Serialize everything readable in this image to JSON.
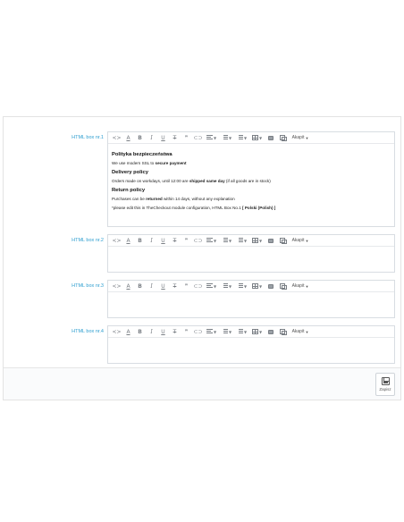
{
  "colors": {
    "label": "#2f9fd0",
    "panel_bg": "#f8f8f8",
    "border": "#d8dde2"
  },
  "toolbar": {
    "code_icon": "code-icon",
    "font_color": "A",
    "bold": "B",
    "italic": "I",
    "underline": "U",
    "strike": "T",
    "quote": "❞",
    "link_icon": "link-icon",
    "format_label": "Akapit"
  },
  "boxes": [
    {
      "label": "HTML box nr.1"
    },
    {
      "label": "HTML box nr.2"
    },
    {
      "label": "HTML box nr.3"
    },
    {
      "label": "HTML box nr.4"
    }
  ],
  "box1_content": {
    "heading1": "Polityka bezpieczeństwa",
    "p1_pre": "We use modern SSL to ",
    "p1_bold": "secure payment",
    "heading2": "Delivery policy",
    "p2_pre": "Orders made on workdays, until 12:00 are ",
    "p2_bold": "shipped same day",
    "p2_post": " (if all goods are in stock)",
    "heading3": "Return policy",
    "p3_pre": "Purchases can be ",
    "p3_bold": "returned",
    "p3_post": " within 14 days, without any explanation",
    "p4_pre": "*please edit this in TheCheckout module configuration, HTML Box No.1 ",
    "p4_bold": "[ Polski (Polish) ]"
  },
  "footer": {
    "save_label": "Zapisz"
  }
}
